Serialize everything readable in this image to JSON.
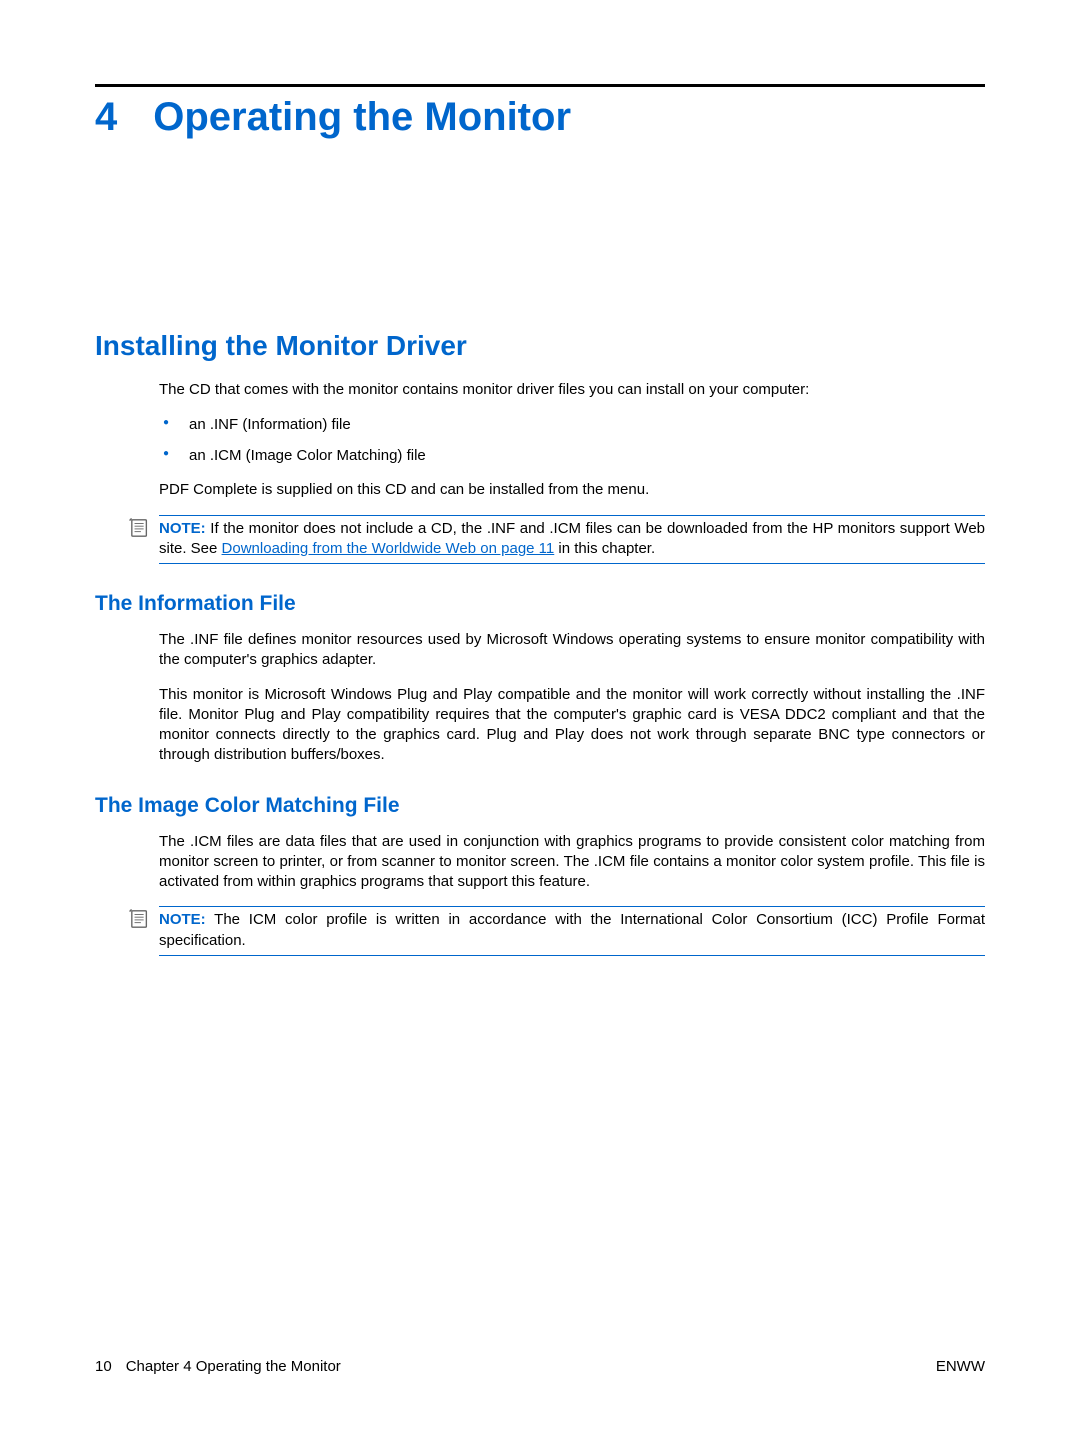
{
  "chapter": {
    "number": "4",
    "title": "Operating the Monitor"
  },
  "section1": {
    "title": "Installing the Monitor Driver",
    "intro": "The CD that comes with the monitor contains monitor driver files you can install on your computer:",
    "bullets": [
      "an .INF (Information) file",
      "an .ICM (Image Color Matching) file"
    ],
    "after_bullets": "PDF Complete is supplied on this CD and can be installed from the menu.",
    "note": {
      "label": "NOTE:",
      "text_before_link": "If the monitor does not include a CD, the .INF and .ICM files can be downloaded from the HP monitors support Web site. See ",
      "link_text": "Downloading from the Worldwide Web on page 11",
      "text_after_link": " in this chapter."
    }
  },
  "subsection1": {
    "title": "The Information File",
    "para1": "The .INF file defines monitor resources used by Microsoft Windows operating systems to ensure monitor compatibility with the computer's graphics adapter.",
    "para2": "This monitor is Microsoft Windows Plug and Play compatible and the monitor will work correctly without installing the .INF file. Monitor Plug and Play compatibility requires that the computer's graphic card is VESA DDC2 compliant and that the monitor connects directly to the graphics card. Plug and Play does not work through separate BNC type connectors or through distribution buffers/boxes."
  },
  "subsection2": {
    "title": "The Image Color Matching File",
    "para1": "The .ICM files are data files that are used in conjunction with graphics programs to provide consistent color matching from monitor screen to printer, or from scanner to monitor screen. The .ICM file contains a monitor color system profile. This file is activated from within graphics programs that support this feature.",
    "note": {
      "label": "NOTE:",
      "text": "The ICM color profile is written in accordance with the International Color Consortium (ICC) Profile Format specification."
    }
  },
  "footer": {
    "page_number": "10",
    "chapter_ref": "Chapter 4   Operating the Monitor",
    "right": "ENWW"
  }
}
